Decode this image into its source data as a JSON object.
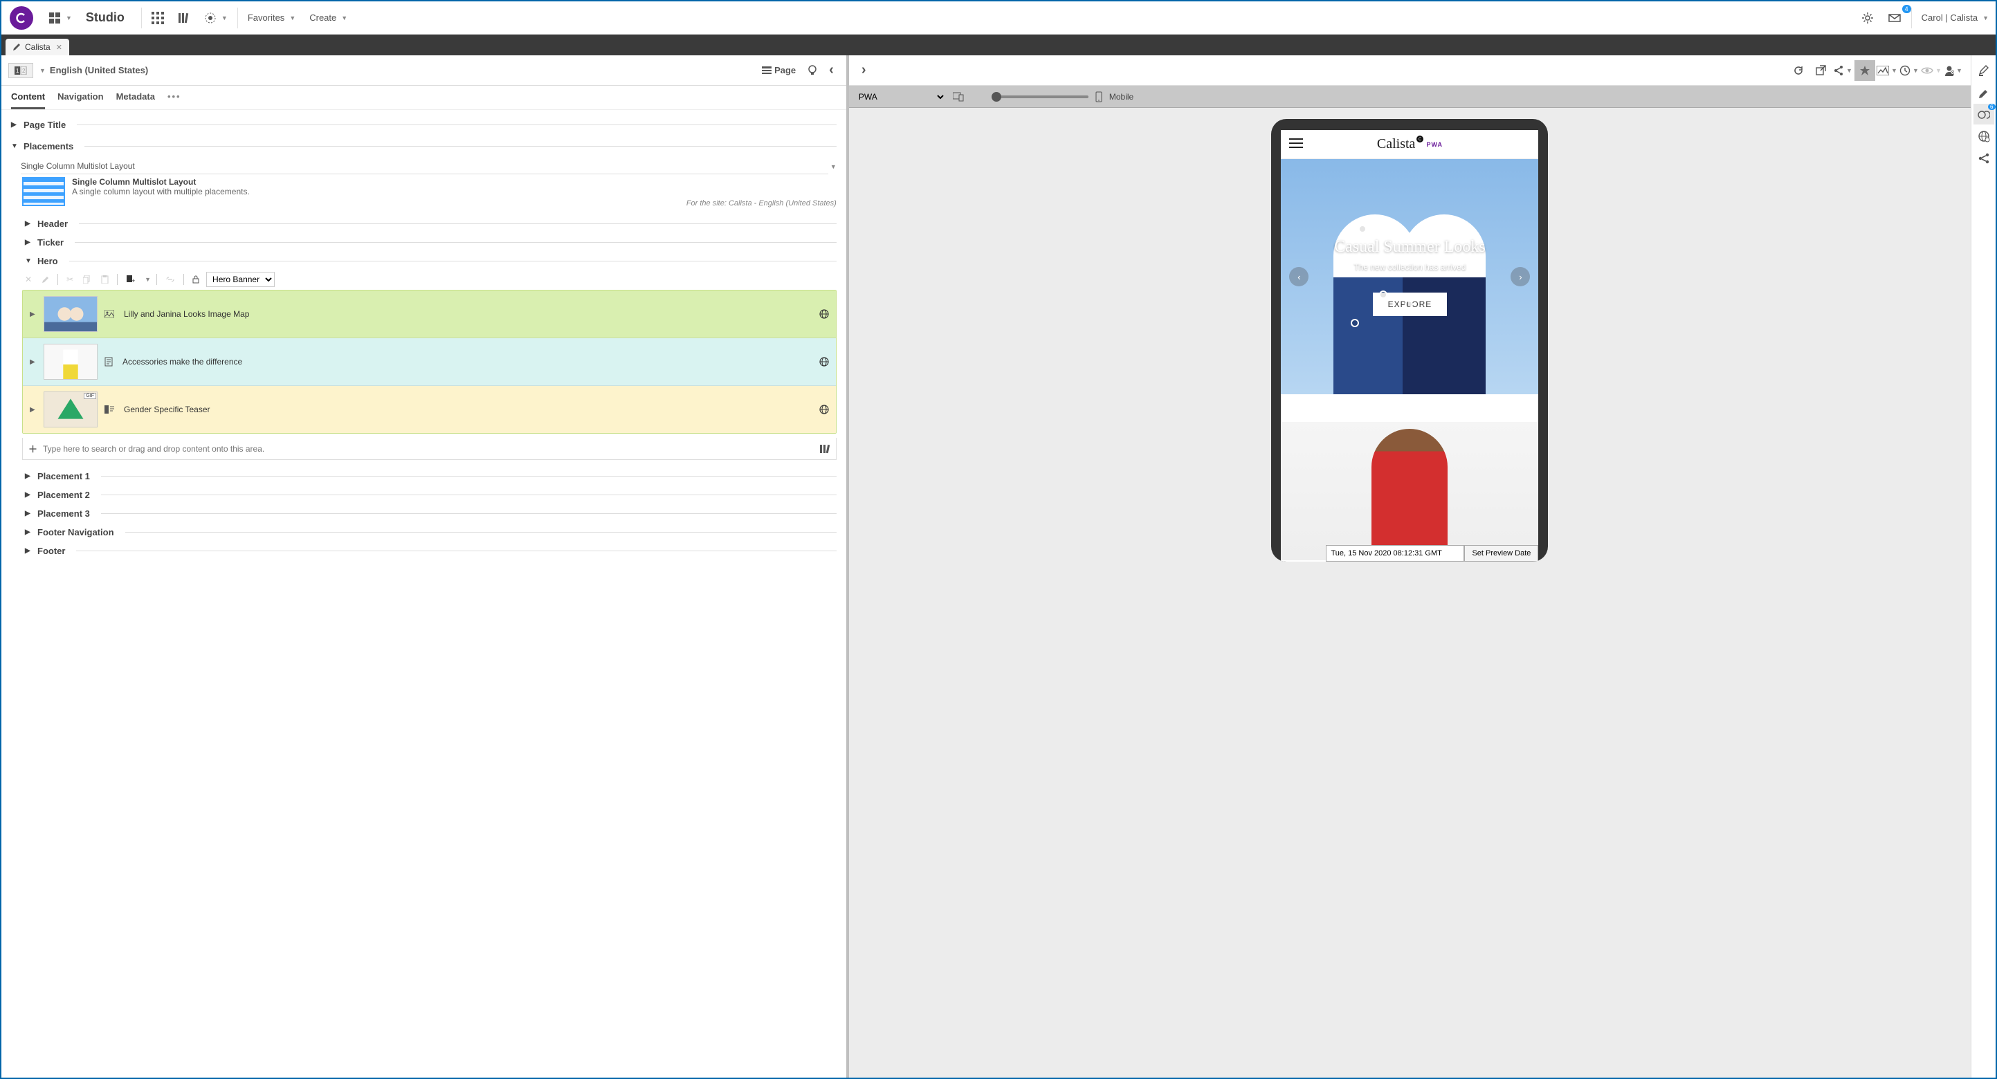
{
  "topbar": {
    "app_title": "Studio",
    "favorites_label": "Favorites",
    "create_label": "Create",
    "user_label": "Carol | Calista",
    "notif_count": "4"
  },
  "doc_tab": {
    "title": "Calista"
  },
  "left_header": {
    "lang_chip": "1 2",
    "locale": "English (United States)",
    "page_label": "Page"
  },
  "left_tabs": {
    "content": "Content",
    "navigation": "Navigation",
    "metadata": "Metadata"
  },
  "sections": {
    "page_title": "Page Title",
    "placements": "Placements"
  },
  "layout": {
    "select_value": "Single Column Multislot Layout",
    "card_title": "Single Column Multislot Layout",
    "card_desc": "A single column layout with multiple placements.",
    "card_site": "For the site: Calista - English (United States)"
  },
  "placements": {
    "header": "Header",
    "ticker": "Ticker",
    "hero": "Hero",
    "placement1": "Placement 1",
    "placement2": "Placement 2",
    "placement3": "Placement 3",
    "footer_nav": "Footer Navigation",
    "footer": "Footer"
  },
  "hero_toolbar": {
    "viewtype_value": "Hero Banner"
  },
  "hero_items": [
    {
      "title": "Lilly and Janina Looks Image Map",
      "color": "green"
    },
    {
      "title": "Accessories make the difference",
      "color": "cyan"
    },
    {
      "title": "Gender Specific Teaser",
      "color": "yellow"
    }
  ],
  "search_row": {
    "placeholder": "Type here to search or drag and drop content onto this area."
  },
  "preview": {
    "channel": "PWA",
    "device_label": "Mobile",
    "brand": "Calista",
    "pwa_badge": "PWA",
    "hero_title": "Casual Summer Looks",
    "hero_sub": "The new collection has arrived",
    "hero_cta": "EXPLORE",
    "timestamp": "Tue, 15 Nov 2020 08:12:31 GMT",
    "set_date_btn": "Set Preview Date"
  },
  "right_rail_badge": "6"
}
